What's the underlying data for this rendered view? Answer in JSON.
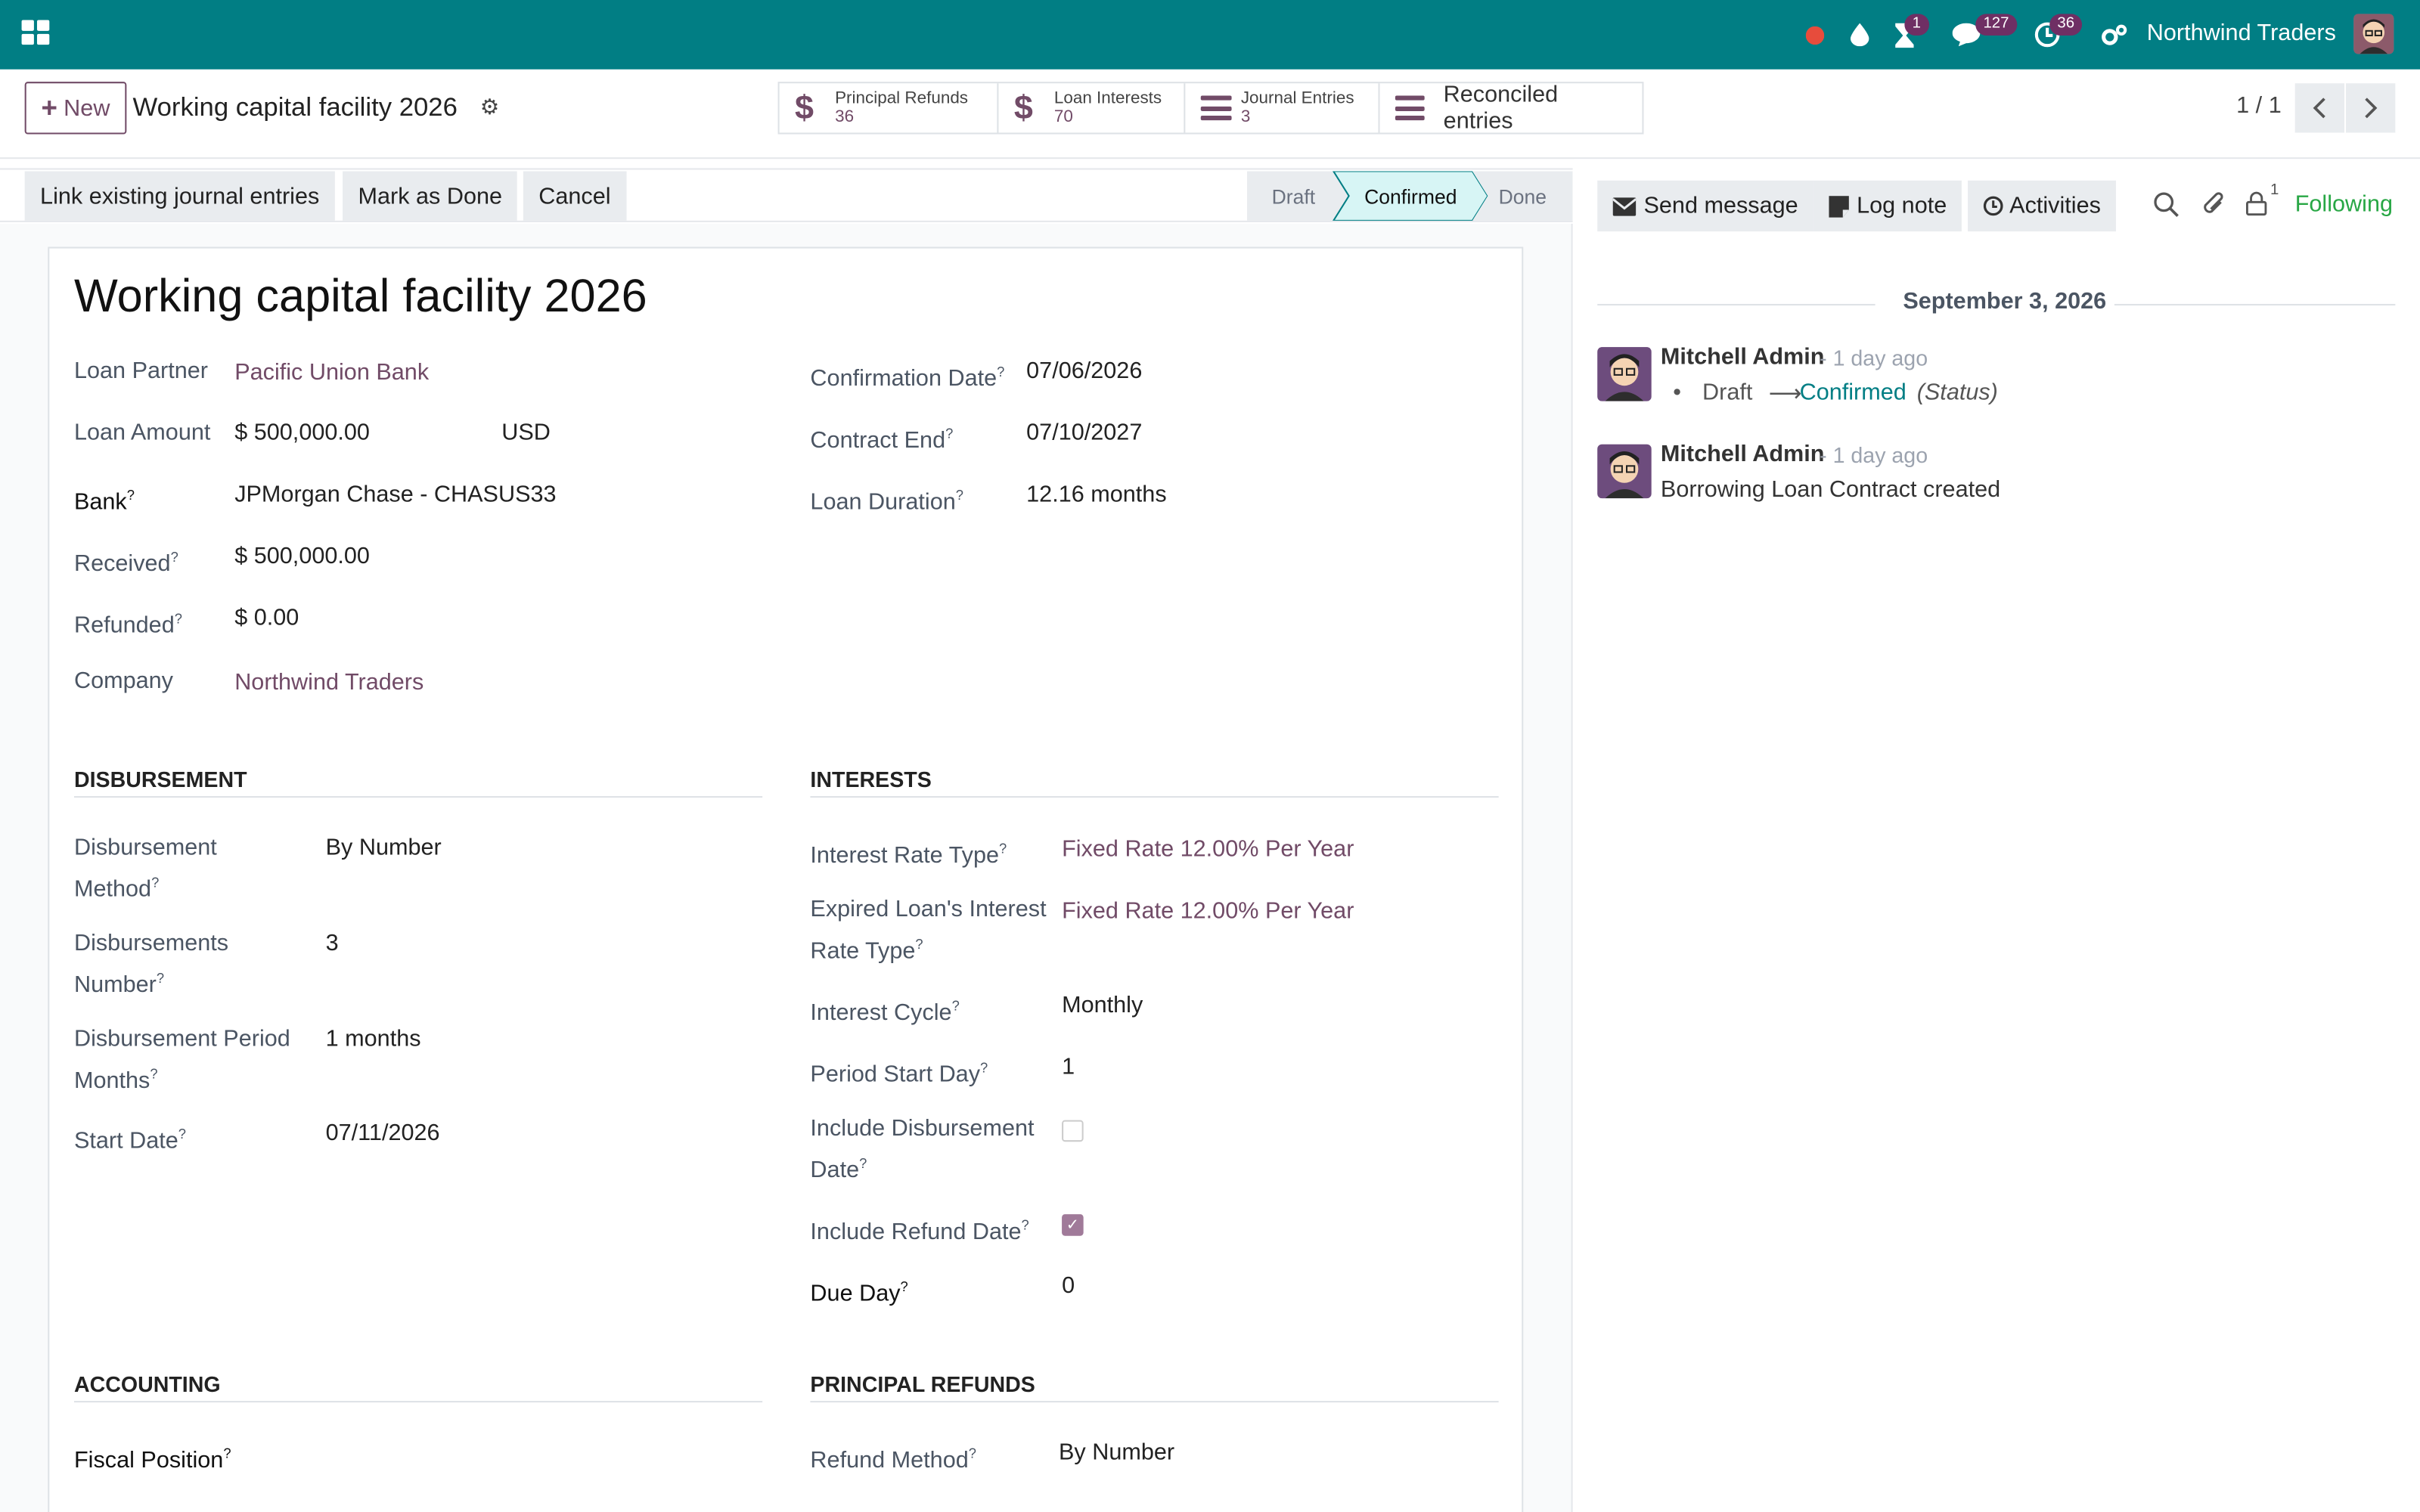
{
  "navbar": {
    "company": "Northwind Traders",
    "badges": {
      "activity": "1",
      "messages": "127",
      "clock": "36"
    }
  },
  "control": {
    "new_label": "New",
    "record_title": "Working capital facility 2026",
    "smart_buttons": [
      {
        "label": "Principal Refunds",
        "value": "36"
      },
      {
        "label": "Loan Interests",
        "value": "70"
      },
      {
        "label": "Journal Entries",
        "value": "3"
      },
      {
        "label": "Reconciled entries"
      }
    ],
    "pager": "1 / 1"
  },
  "statusbar": {
    "actions": [
      "Link existing journal entries",
      "Mark as Done",
      "Cancel"
    ],
    "stages": [
      "Draft",
      "Confirmed",
      "Done"
    ],
    "current_stage": "Confirmed"
  },
  "form": {
    "title": "Working capital facility 2026",
    "loan_partner": {
      "label": "Loan Partner",
      "value": "Pacific Union Bank"
    },
    "loan_amount": {
      "label": "Loan Amount",
      "value": "$ 500,000.00",
      "currency": "USD"
    },
    "bank": {
      "label": "Bank",
      "value": "JPMorgan Chase - CHASUS33"
    },
    "received": {
      "label": "Received",
      "value": "$ 500,000.00"
    },
    "refunded": {
      "label": "Refunded",
      "value": "$ 0.00"
    },
    "company": {
      "label": "Company",
      "value": "Northwind Traders"
    },
    "confirmation_date": {
      "label": "Confirmation Date",
      "value": "07/06/2026"
    },
    "contract_end": {
      "label": "Contract End",
      "value": "07/10/2027"
    },
    "loan_duration": {
      "label": "Loan Duration",
      "value": "12.16 months"
    },
    "disbursement": {
      "title": "DISBURSEMENT",
      "method_l1": "Disbursement",
      "method_l2": "Method",
      "method": "By Number",
      "number_l1": "Disbursements",
      "number_l2": "Number",
      "number": "3",
      "period_l1": "Disbursement Period",
      "period_l2": "Months",
      "period": "1 months",
      "start_label": "Start Date",
      "start": "07/11/2026"
    },
    "interests": {
      "title": "INTERESTS",
      "rate_type_label": "Interest Rate Type",
      "rate_type": "Fixed Rate 12.00% Per Year",
      "expired_l1": "Expired Loan's Interest",
      "expired_l2": "Rate Type",
      "expired": "Fixed Rate 12.00% Per Year",
      "cycle_label": "Interest Cycle",
      "cycle": "Monthly",
      "start_day_label": "Period Start Day",
      "start_day": "1",
      "incl_disb_l1": "Include Disbursement",
      "incl_disb_l2": "Date",
      "incl_disb": false,
      "incl_refund_label": "Include Refund Date",
      "incl_refund": true,
      "due_day_label": "Due Day",
      "due_day": "0"
    },
    "accounting": {
      "title": "ACCOUNTING",
      "fiscal_label": "Fiscal Position"
    },
    "principal_refunds": {
      "title": "PRINCIPAL REFUNDS",
      "method_label": "Refund Method",
      "method": "By Number"
    }
  },
  "chatter": {
    "send_message": "Send message",
    "log_note": "Log note",
    "activities": "Activities",
    "followers_count": "1",
    "following": "Following",
    "date": "September 3, 2026",
    "messages": [
      {
        "author": "Mitchell Admin",
        "ago": "- 1 day ago",
        "from": "Draft",
        "to": "Confirmed",
        "field": "(Status)"
      },
      {
        "author": "Mitchell Admin",
        "ago": "- 1 day ago",
        "body": "Borrowing Loan Contract created"
      }
    ]
  }
}
